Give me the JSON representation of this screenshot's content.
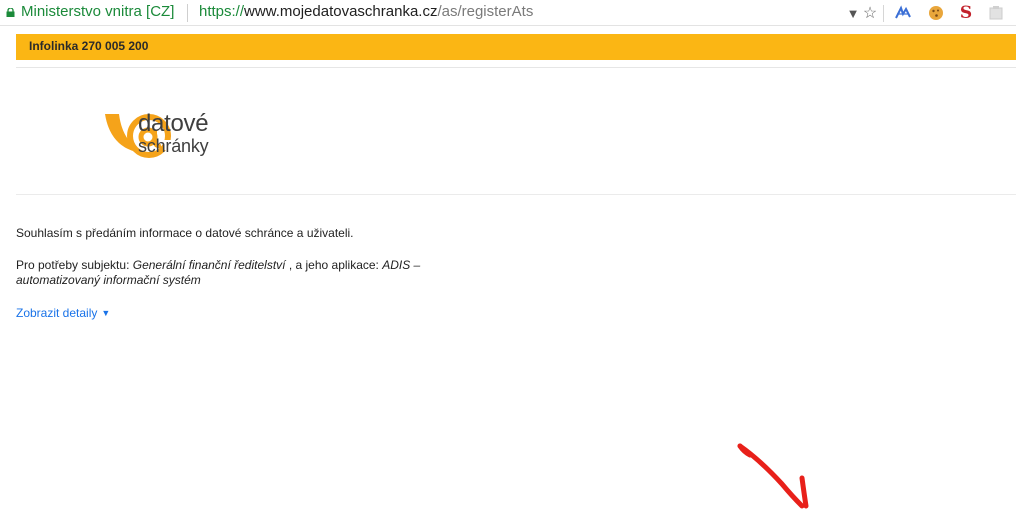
{
  "browser": {
    "site_identity": "Ministerstvo vnitra [CZ]",
    "url_protocol": "https://",
    "url_host": "www.mojedatovaschranka.cz",
    "url_path": "/as/registerAts",
    "icons": [
      "lock-icon",
      "filter-icon",
      "bookmark-star-icon",
      "extension-icon",
      "cookie-icon",
      "s-extension-icon",
      "extension-icon"
    ]
  },
  "infobar": {
    "text": "Infolinka 270 005 200",
    "color": "#fbb614"
  },
  "logo": {
    "line1": "datové",
    "line2": "schránky",
    "color": "#f5a31a"
  },
  "content": {
    "consent_text": "Souhlasím s předáním informace o datové schránce a uživateli.",
    "purpose_prefix": "Pro potřeby subjektu: ",
    "subject_name": "Generální finanční ředitelství",
    "purpose_mid": " , a jeho aplikace: ",
    "app_name": "ADIS – automatizovaný informační systém",
    "details_link": "Zobrazit detaily",
    "details_arrow": "▼"
  },
  "annotation": {
    "arrow_color": "#e8201a"
  }
}
